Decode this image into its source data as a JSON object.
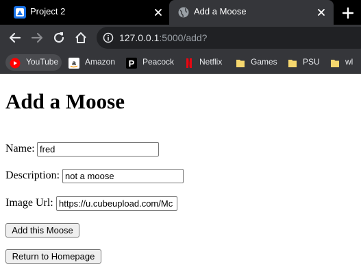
{
  "tabs": [
    {
      "title": "Project 2"
    },
    {
      "title": "Add a Moose"
    }
  ],
  "toolbar": {
    "url_host": "127.0.0.1",
    "url_path": ":5000/add?"
  },
  "bookmarks": [
    {
      "label": "YouTube",
      "icon": "youtube-icon"
    },
    {
      "label": "Amazon",
      "icon": "amazon-icon"
    },
    {
      "label": "Peacock",
      "icon": "peacock-icon"
    },
    {
      "label": "Netflix",
      "icon": "netflix-icon"
    },
    {
      "label": "Games",
      "icon": "folder-icon"
    },
    {
      "label": "PSU",
      "icon": "folder-icon"
    },
    {
      "label": "wl",
      "icon": "folder-icon"
    }
  ],
  "page": {
    "title": "Add a Moose",
    "form": {
      "name_label": "Name:",
      "name_value": "fred",
      "description_label": "Description:",
      "description_value": "not a moose",
      "image_url_label": "Image Url:",
      "image_url_value": "https://u.cubeupload.com/Mc",
      "submit_label": "Add this Moose",
      "home_label": "Return to Homepage"
    }
  },
  "colors": {
    "tabstrip_bg": "#000000",
    "toolbar_bg": "#35363a",
    "omnibox_bg": "#202124",
    "netflix_red": "#e50914",
    "youtube_red": "#ff0000",
    "folder_yellow": "#f5d76e"
  }
}
